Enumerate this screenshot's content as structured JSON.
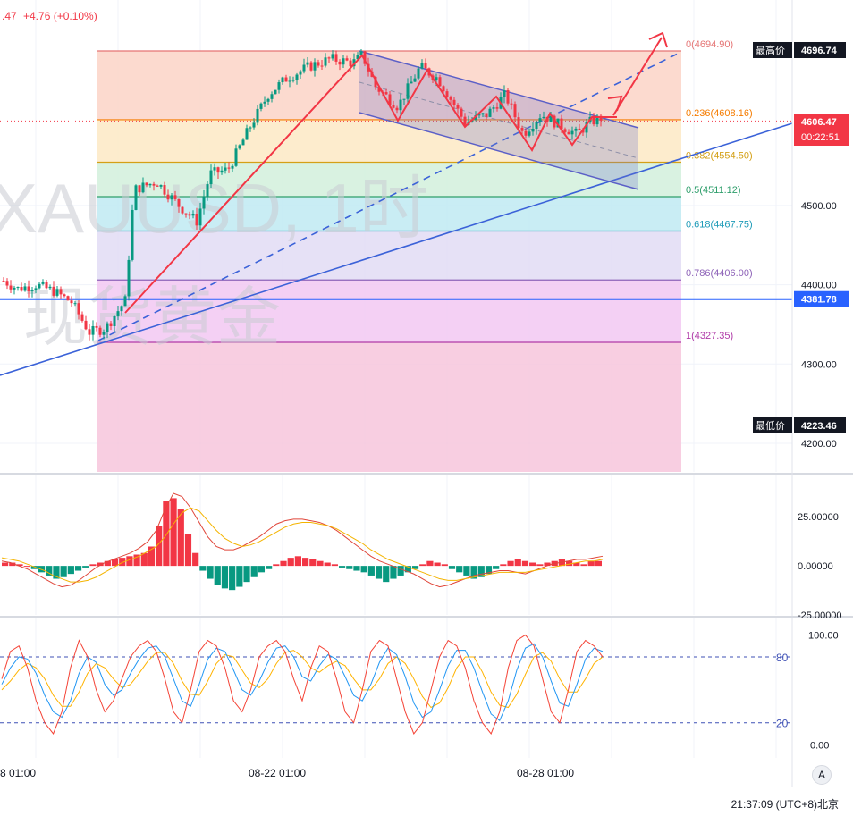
{
  "header": {
    "price_fragment": ".47",
    "change": "+4.76 (+0.10%)"
  },
  "watermark": {
    "line1": "XAUUSD, 1时",
    "line2": "现货黄金"
  },
  "chart_data": [
    {
      "type": "candlestick",
      "title": "XAUUSD, 1时",
      "subtitle": "现货黄金",
      "ylim": [
        4160,
        4720
      ],
      "y_ticks": [
        4200.0,
        4300.0,
        4400.0,
        4500.0
      ],
      "x_ticks": [
        "8 01:00",
        "08-22 01:00",
        "08-28 01:00"
      ],
      "price_labels": [
        {
          "name": "最高价",
          "value": "4696.74"
        },
        {
          "name": "current",
          "value": "4606.47",
          "countdown": "00:22:51"
        },
        {
          "name": "level",
          "value": "4381.78"
        },
        {
          "name": "最低价",
          "value": "4223.46"
        }
      ],
      "fibonacci": [
        {
          "ratio": "0",
          "price": 4694.9,
          "label": "0(4694.90)",
          "color": "#e57373"
        },
        {
          "ratio": "0.236",
          "price": 4608.16,
          "label": "0.236(4608.16)",
          "color": "#f57c00"
        },
        {
          "ratio": "0.382",
          "price": 4554.5,
          "label": "0.382(4554.50)",
          "color": "#d4a017"
        },
        {
          "ratio": "0.5",
          "price": 4511.12,
          "label": "0.5(4511.12)",
          "color": "#2e9e6b"
        },
        {
          "ratio": "0.618",
          "price": 4467.75,
          "label": "0.618(4467.75)",
          "color": "#1e9bb8"
        },
        {
          "ratio": "0.786",
          "price": 4406.0,
          "label": "0.786(4406.00)",
          "color": "#8e63b8"
        },
        {
          "ratio": "1",
          "price": 4327.35,
          "label": "1(4327.35)",
          "color": "#b03aa8"
        }
      ],
      "fib_fills": [
        "#fbd3c7",
        "#fde9c4",
        "#d2f0dc",
        "#bfeaf2",
        "#e2dcf5",
        "#f2c8f2",
        "#f7c6dc"
      ]
    },
    {
      "type": "macd",
      "y_ticks": [
        "25.00000",
        "0.00000",
        "-25.00000"
      ],
      "ylim": [
        -26,
        45
      ],
      "histogram": [
        2,
        2,
        1,
        0,
        -2,
        -4,
        -6,
        -8,
        -7,
        -5,
        -3,
        -1,
        1,
        2,
        3,
        4,
        5,
        6,
        7,
        8,
        12,
        25,
        40,
        42,
        35,
        20,
        8,
        -3,
        -8,
        -12,
        -14,
        -15,
        -13,
        -10,
        -7,
        -4,
        -2,
        1,
        3,
        5,
        6,
        5,
        4,
        3,
        2,
        1,
        -1,
        -2,
        -3,
        -4,
        -6,
        -8,
        -10,
        -8,
        -6,
        -4,
        -2,
        1,
        3,
        2,
        1,
        -2,
        -4,
        -6,
        -8,
        -7,
        -5,
        -2,
        1,
        3,
        4,
        3,
        2,
        1,
        2,
        3,
        4,
        3,
        2,
        1,
        3,
        3
      ],
      "macd_line": [
        3,
        2,
        0,
        -2,
        -5,
        -8,
        -11,
        -13,
        -12,
        -9,
        -5,
        -1,
        2,
        4,
        6,
        8,
        11,
        15,
        22,
        35,
        45,
        43,
        36,
        27,
        18,
        12,
        10,
        10,
        12,
        15,
        18,
        22,
        26,
        28,
        29,
        29,
        28,
        27,
        25,
        22,
        18,
        14,
        10,
        6,
        3,
        1,
        -1,
        -3,
        -5,
        -8,
        -11,
        -13,
        -12,
        -10,
        -8,
        -6,
        -5,
        -4,
        -3,
        -3,
        -4,
        -5,
        -3,
        -1,
        1,
        2,
        3,
        4,
        4,
        5,
        6
      ],
      "signal_line": [
        5,
        4,
        3,
        1,
        -1,
        -3,
        -6,
        -8,
        -10,
        -10,
        -9,
        -7,
        -4,
        -1,
        2,
        4,
        6,
        9,
        12,
        18,
        26,
        33,
        36,
        34,
        28,
        22,
        17,
        14,
        12,
        13,
        15,
        18,
        21,
        24,
        26,
        27,
        27,
        26,
        25,
        23,
        20,
        17,
        14,
        10,
        7,
        4,
        2,
        0,
        -2,
        -4,
        -6,
        -8,
        -9,
        -9,
        -8,
        -7,
        -6,
        -5,
        -4,
        -4,
        -4,
        -4,
        -3,
        -2,
        -1,
        0,
        1,
        2,
        3,
        3,
        4
      ]
    },
    {
      "type": "stochastic",
      "y_ticks": [
        "100.00",
        "0.00"
      ],
      "levels": [
        {
          "value": 80,
          "label": "80"
        },
        {
          "value": 20,
          "label": "20"
        }
      ],
      "ylim": [
        -12,
        115
      ],
      "k_line": [
        60,
        85,
        90,
        70,
        40,
        20,
        10,
        30,
        70,
        95,
        80,
        50,
        30,
        40,
        60,
        80,
        90,
        95,
        85,
        60,
        30,
        20,
        50,
        85,
        95,
        90,
        70,
        40,
        30,
        50,
        80,
        90,
        95,
        85,
        60,
        40,
        70,
        90,
        85,
        60,
        30,
        20,
        50,
        85,
        95,
        90,
        60,
        30,
        10,
        20,
        50,
        80,
        95,
        90,
        70,
        40,
        20,
        10,
        30,
        70,
        95,
        100,
        90,
        60,
        30,
        20,
        50,
        85,
        95,
        90,
        80
      ],
      "d_line": [
        55,
        70,
        80,
        78,
        65,
        45,
        30,
        25,
        40,
        65,
        80,
        75,
        55,
        45,
        50,
        65,
        78,
        88,
        90,
        80,
        60,
        40,
        35,
        55,
        78,
        88,
        85,
        68,
        50,
        45,
        58,
        75,
        88,
        90,
        80,
        62,
        58,
        72,
        82,
        78,
        62,
        45,
        40,
        55,
        75,
        88,
        82,
        62,
        38,
        25,
        30,
        50,
        72,
        86,
        86,
        70,
        48,
        28,
        22,
        40,
        68,
        88,
        92,
        80,
        58,
        38,
        35,
        55,
        78,
        88,
        85
      ],
      "slow_line": [
        50,
        58,
        68,
        74,
        70,
        60,
        45,
        35,
        35,
        48,
        65,
        74,
        70,
        60,
        52,
        55,
        65,
        76,
        84,
        84,
        74,
        58,
        46,
        45,
        58,
        74,
        82,
        80,
        68,
        56,
        52,
        60,
        74,
        84,
        86,
        80,
        70,
        66,
        72,
        76,
        72,
        60,
        50,
        50,
        60,
        74,
        80,
        74,
        60,
        44,
        34,
        38,
        52,
        70,
        80,
        80,
        66,
        48,
        36,
        34,
        46,
        64,
        80,
        84,
        76,
        60,
        48,
        48,
        60,
        74,
        80
      ]
    }
  ],
  "footer": {
    "clock": "21:37:09",
    "timezone": "(UTC+8)北京",
    "auto_button": "A"
  },
  "colors": {
    "up": "#089981",
    "down": "#f23645",
    "red_drawing": "#f23645",
    "blue_drawing": "#2962ff",
    "channel": "#5b5fc7",
    "macd_line": "#e0463a",
    "signal_line": "#f4b400",
    "stoch_k": "#f44336",
    "stoch_d": "#2196f3",
    "stoch_slow": "#ffb300"
  }
}
